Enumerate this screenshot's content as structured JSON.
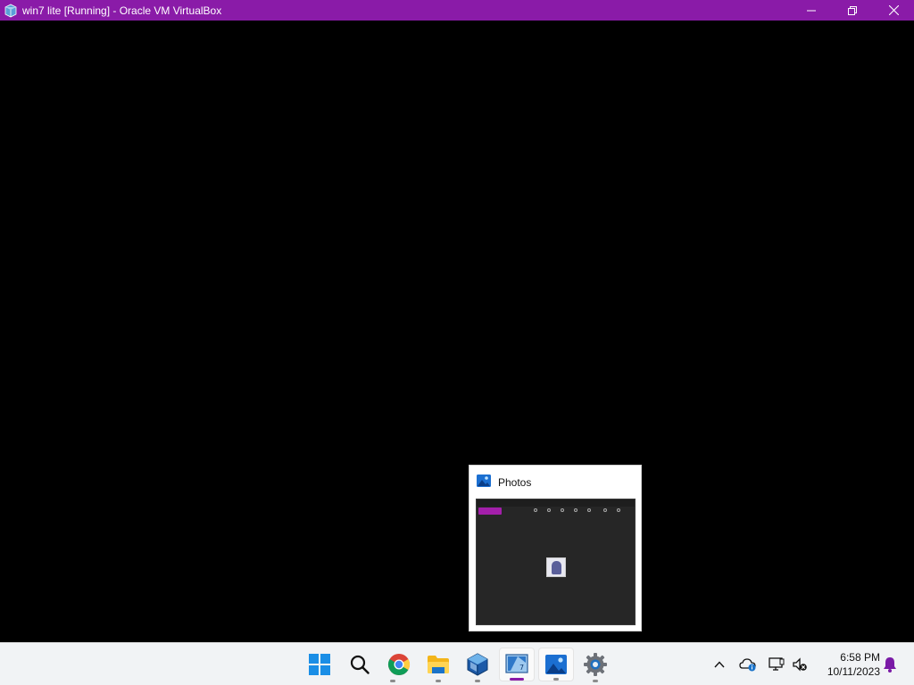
{
  "window": {
    "title": "win7 lite [Running] - Oracle VM VirtualBox",
    "accent_color": "#8a1ba8",
    "controls": [
      "minimize-icon",
      "restore-icon",
      "close-icon"
    ]
  },
  "preview": {
    "title": "Photos",
    "icon": "photos-icon"
  },
  "taskbar": {
    "items": [
      {
        "name": "start-button",
        "icon": "windows-start-icon"
      },
      {
        "name": "search-button",
        "icon": "search-icon"
      },
      {
        "name": "chrome-button",
        "icon": "chrome-icon"
      },
      {
        "name": "file-explorer-button",
        "icon": "folder-icon"
      },
      {
        "name": "virtualbox-manager-button",
        "icon": "virtualbox-icon"
      },
      {
        "name": "virtualbox-vm-button",
        "icon": "virtualbox-vm-icon"
      },
      {
        "name": "photos-button",
        "icon": "photos-icon"
      },
      {
        "name": "settings-button",
        "icon": "gear-icon"
      }
    ],
    "tray": {
      "icons": [
        "chevron-up-icon",
        "onedrive-icon",
        "network-icon",
        "volume-muted-icon",
        "notification-bell-icon"
      ]
    },
    "clock": {
      "time": "6:58 PM",
      "date": "10/11/2023"
    }
  }
}
